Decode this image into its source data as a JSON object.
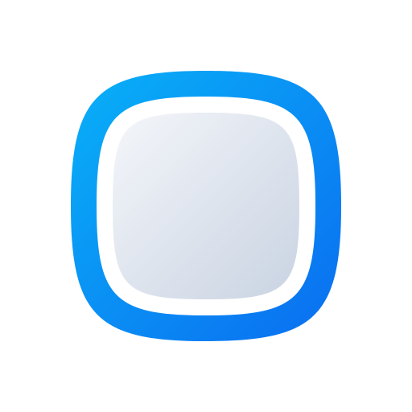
{
  "icon": {
    "name": "rounded-square-frame-icon",
    "colors": {
      "background": "#ffffff",
      "frame_gradient_start": "#09B1F8",
      "frame_gradient_end": "#0A6DF0",
      "inner_gap": "#ffffff",
      "tile_gradient_start": "#F4F6FA",
      "tile_gradient_end": "#C9D3E2"
    }
  }
}
